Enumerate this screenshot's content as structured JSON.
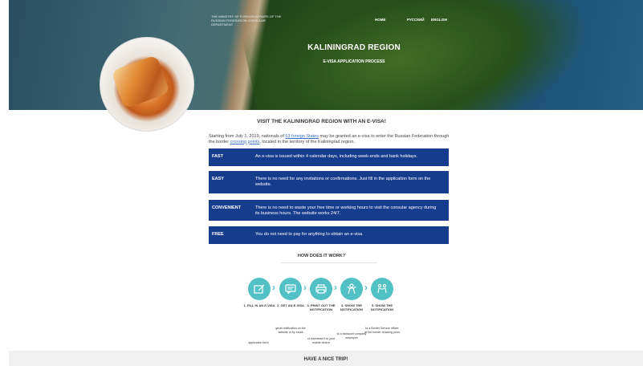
{
  "header": {
    "ministry": "THE MINISTRY OF FOREIGN AFFAIRS OF THE RUSSIAN FEDERATION CONSULAR DEPARTMENT",
    "nav": {
      "home": "HOME",
      "russian": "РУССКИЙ",
      "english": "ENGLISH"
    },
    "title": "KALININGRAD REGION",
    "subtitle": "E-VISA APPLICATION PROCESS"
  },
  "main": {
    "heading": "VISIT THE KALININGRAD REGION WITH AN E-VISA!",
    "intro": {
      "part1": "Starting from July 1, 2019, nationals of ",
      "link1": "53 foreign States",
      "part2": " may be granted an e-visa to enter the Russian Federation through the border ",
      "link2": "crossing points",
      "part3": ", located in the territory of the Kaliningrad region."
    },
    "features": [
      {
        "title": "FAST",
        "text": "An e-visa is issued within 4 calendar days, including week-ends and bank holidays."
      },
      {
        "title": "EASY",
        "text": "There is no need for any invitations or confirmations. Just fill in the application form on the website."
      },
      {
        "title": "CONVENIENT",
        "text": "There is no need to waste your free time or working hours to visit the consular agency during its business hours. The website works 24/7."
      },
      {
        "title": "FREE",
        "text": "You do not need to pay for anything to obtain an e-visa."
      }
    ],
    "how_heading": "HOW DOES IT WORK?",
    "steps": [
      {
        "label": "1. FILL IN AN E-VISA",
        "note": "application form",
        "icon": "form-icon"
      },
      {
        "label": "2. GET AN E-VISA",
        "note": "great notification on the website or by email",
        "icon": "message-icon"
      },
      {
        "label": "3. PRINT OUT THE NOTIFICATION",
        "note": "or download it to your mobile device",
        "icon": "printer-icon"
      },
      {
        "label": "4. SHOW THE NOTIFICATION",
        "note": "to a transport company employee",
        "icon": "person-icon"
      },
      {
        "label": "5. SHOW THE NOTIFICATION",
        "note": "to a Border Service officer at the border crossing point",
        "icon": "officer-icon"
      }
    ],
    "footer": "HAVE A NICE TRIP!"
  },
  "colors": {
    "accent_blue": "#163c8c",
    "teal": "#52c1c6",
    "link": "#3a6fbf"
  }
}
